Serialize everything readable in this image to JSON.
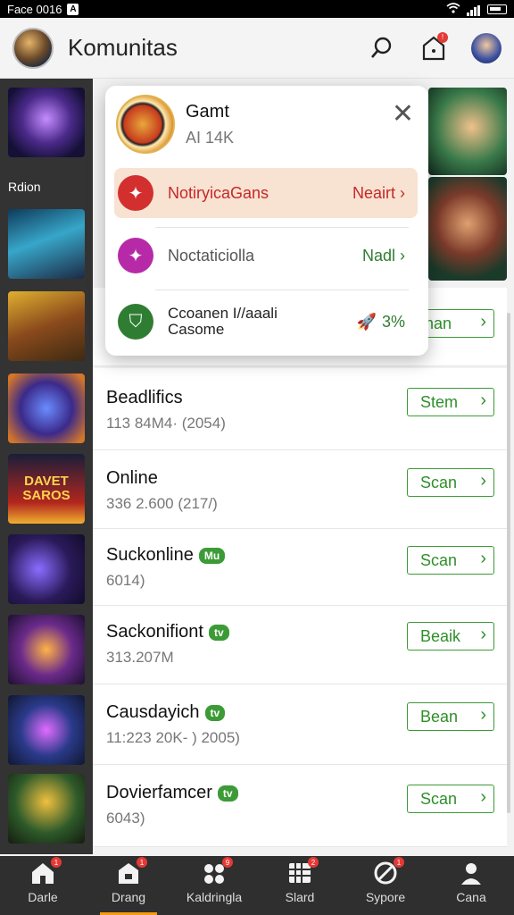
{
  "status_bar": {
    "left_text": "Face 0016",
    "app_icon_glyph": "A"
  },
  "header": {
    "title": "Komunitas"
  },
  "thumbs": {
    "label": "Rdion",
    "banner_text": "DAVET SAROS"
  },
  "popup": {
    "name": "Gamt",
    "stat": "AI 14K",
    "items": [
      {
        "label": "NotiryicaGans",
        "right": "Neairt ›",
        "icon": "compass-icon",
        "color": "#d32f2f"
      },
      {
        "label": "Noctaticiolla",
        "right": "Nadl ›",
        "icon": "star-icon",
        "color": "#b62aa8"
      },
      {
        "label": "Ccoanen I//aaali",
        "label2": "Casome",
        "right": "3%",
        "icon": "shield-icon",
        "color": "#2e7d32"
      }
    ]
  },
  "list": {
    "peek_button": "man",
    "rows": [
      {
        "name": "Beadlifics",
        "sub": "113 84M4· (2054)",
        "badge": "",
        "action": "Stem"
      },
      {
        "name": "Online",
        "sub": "336 2.600  (217/)",
        "badge": "",
        "action": "Scan"
      },
      {
        "name": "Suckonline",
        "sub": "6014)",
        "badge": "Mu",
        "action": "Scan"
      },
      {
        "name": "Sackonifiont",
        "sub": "313.207M",
        "badge": "tv",
        "action": "Beaik"
      },
      {
        "name": "Causdayich",
        "sub": "11:223 20K- ) 2005)",
        "badge": "tv",
        "action": "Bean"
      },
      {
        "name": "Dovierfamcer",
        "sub": "6043)",
        "badge": "tv",
        "action": "Scan"
      }
    ]
  },
  "bottom_nav": [
    {
      "label": "Darle",
      "icon": "home-icon",
      "badge": "1"
    },
    {
      "label": "Drang",
      "icon": "store-icon",
      "badge": "1"
    },
    {
      "label": "Kaldringla",
      "icon": "group-icon",
      "badge": "9"
    },
    {
      "label": "Slard",
      "icon": "grid-icon",
      "badge": "2"
    },
    {
      "label": "Sypore",
      "icon": "ball-icon",
      "badge": "1"
    },
    {
      "label": "Cana",
      "icon": "profile-icon",
      "badge": ""
    }
  ],
  "colors": {
    "accent_green": "#3c9b36",
    "badge_red": "#e53935",
    "active_tab": "#f39c12"
  }
}
